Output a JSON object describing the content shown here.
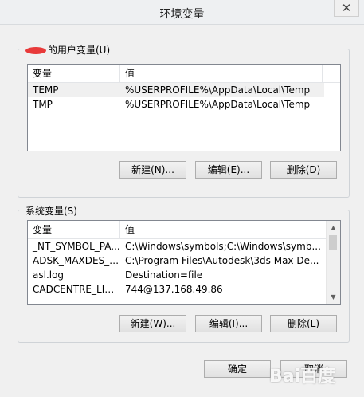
{
  "window": {
    "title": "环境变量",
    "close_glyph": "✕"
  },
  "user_vars": {
    "group_label": "的用户变量(U)",
    "columns": [
      "变量",
      "值"
    ],
    "rows": [
      {
        "name": "TEMP",
        "value": "%USERPROFILE%\\AppData\\Local\\Temp"
      },
      {
        "name": "TMP",
        "value": "%USERPROFILE%\\AppData\\Local\\Temp"
      }
    ],
    "new_label": "新建(N)...",
    "edit_label": "编辑(E)...",
    "delete_label": "删除(D)"
  },
  "system_vars": {
    "group_label": "系统变量(S)",
    "columns": [
      "变量",
      "值"
    ],
    "rows": [
      {
        "name": "_NT_SYMBOL_PA...",
        "value": "C:\\Windows\\symbols;C:\\Windows\\symb..."
      },
      {
        "name": "ADSK_MAXDES_x...",
        "value": "C:\\Program Files\\Autodesk\\3ds Max De..."
      },
      {
        "name": "asl.log",
        "value": "Destination=file"
      },
      {
        "name": "CADCENTRE_LIC...",
        "value": "744@137.168.49.86"
      }
    ],
    "new_label": "新建(W)...",
    "edit_label": "编辑(I)...",
    "delete_label": "删除(L)"
  },
  "dialog": {
    "ok_label": "确定",
    "cancel_label": "取消"
  },
  "watermark": {
    "text": "Bai百度"
  }
}
